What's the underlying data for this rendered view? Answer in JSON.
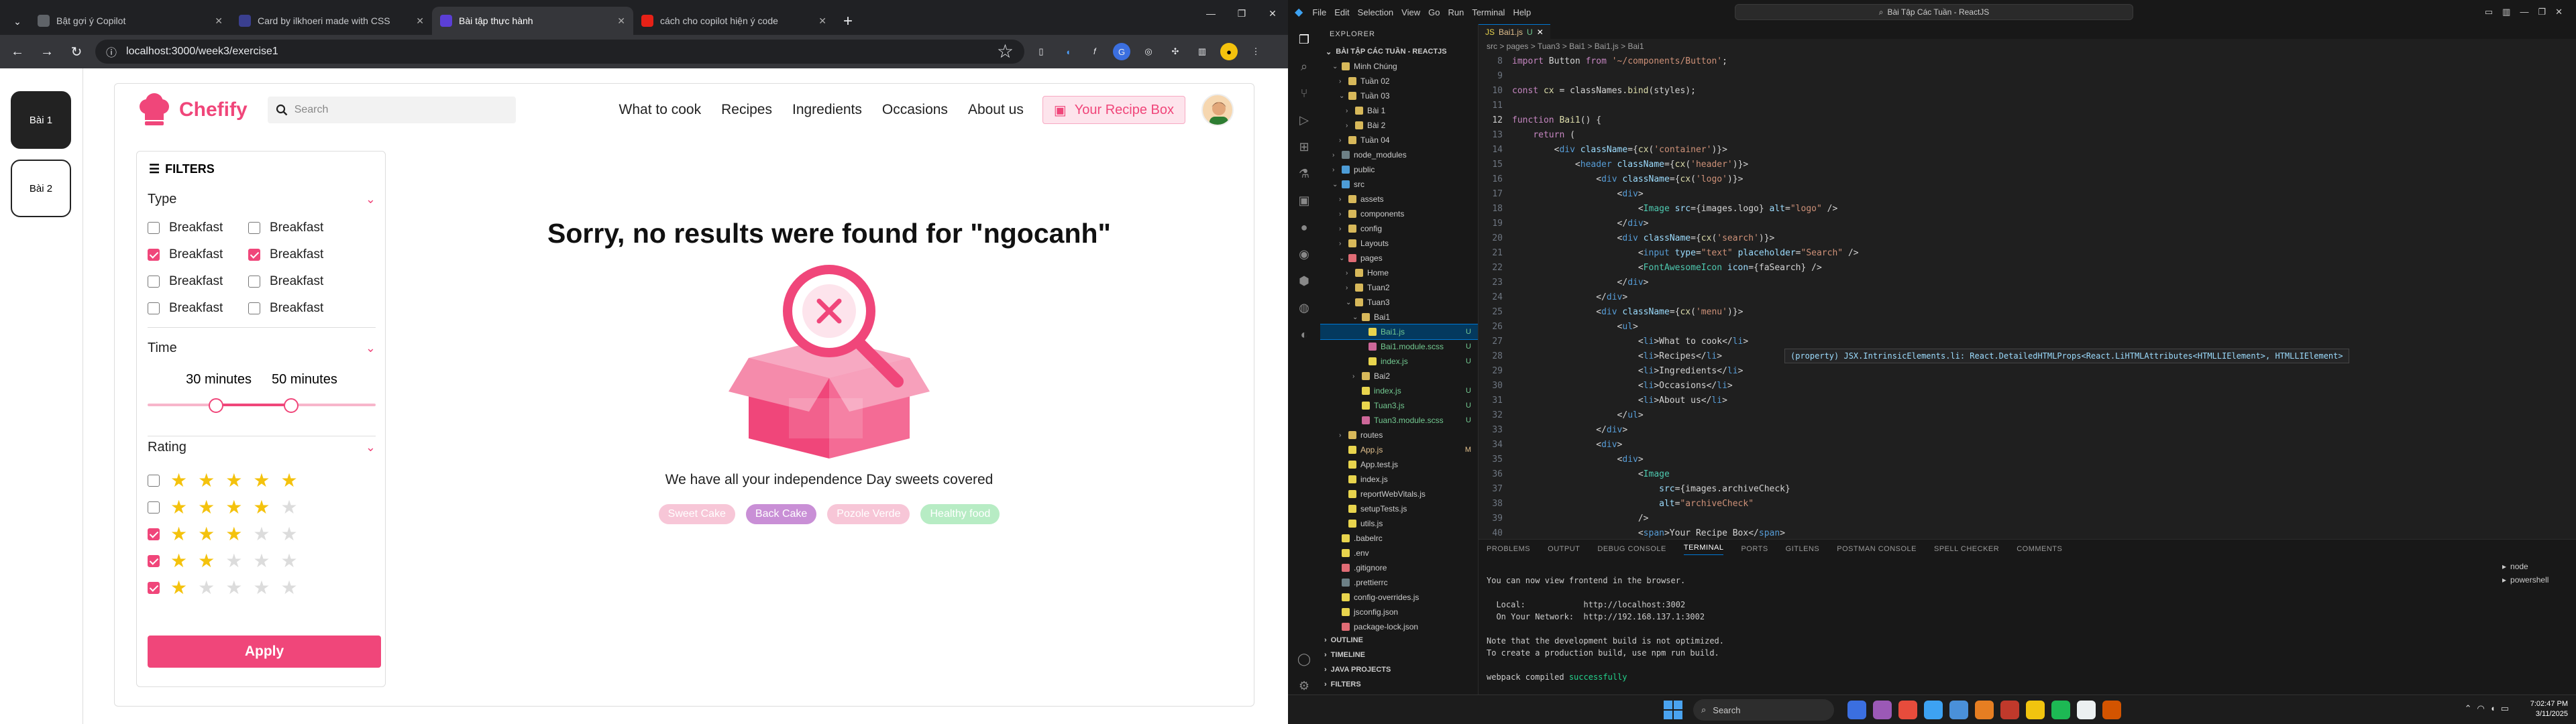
{
  "browser": {
    "tabs": [
      {
        "title": "Bật gợi ý Copilot",
        "color": "#5f6368",
        "active": false
      },
      {
        "title": "Card by ilkhoeri made with CSS",
        "color": "#3a3f8f",
        "active": false
      },
      {
        "title": "Bài tập thực hành",
        "color": "#5b3fd6",
        "active": true
      },
      {
        "title": "cách cho copilot hiện ý code",
        "color": "#e62117",
        "active": false
      }
    ],
    "url": "localhost:3000/week3/exercise1"
  },
  "lessons": [
    "Bài 1",
    "Bài 2"
  ],
  "app": {
    "brand": "Chefify",
    "search_placeholder": "Search",
    "menu": [
      "What to cook",
      "Recipes",
      "Ingredients",
      "Occasions",
      "About us"
    ],
    "recipe_box": "Your Recipe Box",
    "filters_title": "FILTERS",
    "type": {
      "label": "Type",
      "items": [
        {
          "label": "Breakfast",
          "checked": false
        },
        {
          "label": "Breakfast",
          "checked": false
        },
        {
          "label": "Breakfast",
          "checked": true
        },
        {
          "label": "Breakfast",
          "checked": true
        },
        {
          "label": "Breakfast",
          "checked": false
        },
        {
          "label": "Breakfast",
          "checked": false
        },
        {
          "label": "Breakfast",
          "checked": false
        },
        {
          "label": "Breakfast",
          "checked": false
        }
      ]
    },
    "time": {
      "label": "Time",
      "min_label": "30 minutes",
      "max_label": "50 minutes",
      "range_min": 0.3,
      "range_max": 0.63
    },
    "rating": {
      "label": "Rating",
      "rows": [
        {
          "checked": false,
          "stars": 5
        },
        {
          "checked": false,
          "stars": 4
        },
        {
          "checked": true,
          "stars": 3
        },
        {
          "checked": true,
          "stars": 2
        },
        {
          "checked": true,
          "stars": 1
        }
      ]
    },
    "apply_label": "Apply",
    "result_title": "Sorry, no results were found for \"ngocanh\"",
    "result_sub": "We have all your independence Day sweets covered",
    "chips": [
      {
        "label": "Sweet Cake",
        "color": "#f7c6d7"
      },
      {
        "label": "Back Cake",
        "color": "#c98fd6"
      },
      {
        "label": "Pozole Verde",
        "color": "#f7c6d7"
      },
      {
        "label": "Healthy food",
        "color": "#b7ecc4"
      }
    ]
  },
  "vscode": {
    "menu": [
      "File",
      "Edit",
      "Selection",
      "View",
      "Go",
      "Run",
      "Terminal",
      "Help"
    ],
    "search": "Bài Tập Các Tuần - ReactJS",
    "explorer_title": "EXPLORER",
    "root": "BÀI TẬP CÁC TUẦN - REACTJS",
    "tree": [
      {
        "name": "Minh Chúng",
        "depth": 1,
        "kind": "folder",
        "open": true,
        "color": "#d7b85a",
        "badge": "",
        "selected": false
      },
      {
        "name": "Tuần 02",
        "depth": 2,
        "kind": "folder",
        "open": false,
        "color": "#d7b85a",
        "badge": "",
        "selected": false
      },
      {
        "name": "Tuần 03",
        "depth": 2,
        "kind": "folder",
        "open": true,
        "color": "#d7b85a",
        "badge": "",
        "selected": false
      },
      {
        "name": "Bài 1",
        "depth": 3,
        "kind": "folder",
        "open": false,
        "color": "#d7b85a",
        "badge": "",
        "selected": false
      },
      {
        "name": "Bài 2",
        "depth": 3,
        "kind": "folder",
        "open": false,
        "color": "#d7b85a",
        "badge": "",
        "selected": false
      },
      {
        "name": "Tuần 04",
        "depth": 2,
        "kind": "folder",
        "open": false,
        "color": "#d7b85a",
        "badge": "",
        "selected": false
      },
      {
        "name": "node_modules",
        "depth": 1,
        "kind": "folder",
        "open": false,
        "color": "#6d8086",
        "badge": "",
        "selected": false
      },
      {
        "name": "public",
        "depth": 1,
        "kind": "folder",
        "open": false,
        "color": "#4d9cd6",
        "badge": "",
        "selected": false
      },
      {
        "name": "src",
        "depth": 1,
        "kind": "folder",
        "open": true,
        "color": "#4d9cd6",
        "badge": "",
        "selected": false
      },
      {
        "name": "assets",
        "depth": 2,
        "kind": "folder",
        "open": false,
        "color": "#d7b85a",
        "badge": "",
        "selected": false
      },
      {
        "name": "components",
        "depth": 2,
        "kind": "folder",
        "open": false,
        "color": "#d7b85a",
        "badge": "",
        "selected": false
      },
      {
        "name": "config",
        "depth": 2,
        "kind": "folder",
        "open": false,
        "color": "#d7b85a",
        "badge": "",
        "selected": false
      },
      {
        "name": "Layouts",
        "depth": 2,
        "kind": "folder",
        "open": false,
        "color": "#d7b85a",
        "badge": "",
        "selected": false
      },
      {
        "name": "pages",
        "depth": 2,
        "kind": "folder",
        "open": true,
        "color": "#e06c75",
        "badge": "",
        "selected": false
      },
      {
        "name": "Home",
        "depth": 3,
        "kind": "folder",
        "open": false,
        "color": "#d7b85a",
        "badge": "",
        "selected": false
      },
      {
        "name": "Tuan2",
        "depth": 3,
        "kind": "folder",
        "open": false,
        "color": "#d7b85a",
        "badge": "",
        "selected": false
      },
      {
        "name": "Tuan3",
        "depth": 3,
        "kind": "folder",
        "open": true,
        "color": "#d7b85a",
        "badge": "",
        "selected": false
      },
      {
        "name": "Bai1",
        "depth": 4,
        "kind": "folder",
        "open": true,
        "color": "#d7b85a",
        "badge": "",
        "selected": false
      },
      {
        "name": "Bai1.js",
        "depth": 5,
        "kind": "file",
        "open": false,
        "color": "#e8d44d",
        "badge": "U",
        "selected": true
      },
      {
        "name": "Bai1.module.scss",
        "depth": 5,
        "kind": "file",
        "open": false,
        "color": "#cd6799",
        "badge": "U",
        "selected": false
      },
      {
        "name": "index.js",
        "depth": 5,
        "kind": "file",
        "open": false,
        "color": "#e8d44d",
        "badge": "U",
        "selected": false
      },
      {
        "name": "Bai2",
        "depth": 4,
        "kind": "folder",
        "open": false,
        "color": "#d7b85a",
        "badge": "",
        "selected": false
      },
      {
        "name": "index.js",
        "depth": 4,
        "kind": "file",
        "open": false,
        "color": "#e8d44d",
        "badge": "U",
        "selected": false
      },
      {
        "name": "Tuan3.js",
        "depth": 4,
        "kind": "file",
        "open": false,
        "color": "#e8d44d",
        "badge": "U",
        "selected": false
      },
      {
        "name": "Tuan3.module.scss",
        "depth": 4,
        "kind": "file",
        "open": false,
        "color": "#cd6799",
        "badge": "U",
        "selected": false
      },
      {
        "name": "routes",
        "depth": 2,
        "kind": "folder",
        "open": false,
        "color": "#d7b85a",
        "badge": "",
        "selected": false
      },
      {
        "name": "App.js",
        "depth": 2,
        "kind": "file",
        "open": false,
        "color": "#e8d44d",
        "badge": "M",
        "selected": false
      },
      {
        "name": "App.test.js",
        "depth": 2,
        "kind": "file",
        "open": false,
        "color": "#e8d44d",
        "badge": "",
        "selected": false
      },
      {
        "name": "index.js",
        "depth": 2,
        "kind": "file",
        "open": false,
        "color": "#e8d44d",
        "badge": "",
        "selected": false
      },
      {
        "name": "reportWebVitals.js",
        "depth": 2,
        "kind": "file",
        "open": false,
        "color": "#e8d44d",
        "badge": "",
        "selected": false
      },
      {
        "name": "setupTests.js",
        "depth": 2,
        "kind": "file",
        "open": false,
        "color": "#e8d44d",
        "badge": "",
        "selected": false
      },
      {
        "name": "utils.js",
        "depth": 2,
        "kind": "file",
        "open": false,
        "color": "#e8d44d",
        "badge": "",
        "selected": false
      },
      {
        "name": ".babelrc",
        "depth": 1,
        "kind": "file",
        "open": false,
        "color": "#e8d44d",
        "badge": "",
        "selected": false
      },
      {
        "name": ".env",
        "depth": 1,
        "kind": "file",
        "open": false,
        "color": "#e8d44d",
        "badge": "",
        "selected": false
      },
      {
        "name": ".gitignore",
        "depth": 1,
        "kind": "file",
        "open": false,
        "color": "#e06c75",
        "badge": "",
        "selected": false
      },
      {
        "name": ".prettierrc",
        "depth": 1,
        "kind": "file",
        "open": false,
        "color": "#6d8086",
        "badge": "",
        "selected": false
      },
      {
        "name": "config-overrides.js",
        "depth": 1,
        "kind": "file",
        "open": false,
        "color": "#e8d44d",
        "badge": "",
        "selected": false
      },
      {
        "name": "jsconfig.json",
        "depth": 1,
        "kind": "file",
        "open": false,
        "color": "#e8d44d",
        "badge": "",
        "selected": false
      },
      {
        "name": "package-lock.json",
        "depth": 1,
        "kind": "file",
        "open": false,
        "color": "#e06c75",
        "badge": "",
        "selected": false
      }
    ],
    "outline_sections": [
      "OUTLINE",
      "TIMELINE",
      "JAVA PROJECTS",
      "FILTERS"
    ],
    "editor_tab": "Bai1.js",
    "editor_tab_badge": "U",
    "breadcrumb": "src > pages > Tuan3 > Bai1 > Bai1.js > Bai1",
    "code": [
      {
        "n": "8",
        "text": "import Button from '~/components/Button';"
      },
      {
        "n": "9",
        "text": ""
      },
      {
        "n": "10",
        "text": "const cx = classNames.bind(styles);"
      },
      {
        "n": "11",
        "text": ""
      },
      {
        "n": "12",
        "text": "function Bai1() {"
      },
      {
        "n": "13",
        "text": "    return ("
      },
      {
        "n": "14",
        "text": "        <div className={cx('container')}>"
      },
      {
        "n": "15",
        "text": "            <header className={cx('header')}>"
      },
      {
        "n": "16",
        "text": "                <div className={cx('logo')}>"
      },
      {
        "n": "17",
        "text": "                    <div>"
      },
      {
        "n": "18",
        "text": "                        <Image src={images.logo} alt=\"logo\" />"
      },
      {
        "n": "19",
        "text": "                    </div>"
      },
      {
        "n": "20",
        "text": "                    <div className={cx('search')}>"
      },
      {
        "n": "21",
        "text": "                        <input type=\"text\" placeholder=\"Search\" />"
      },
      {
        "n": "22",
        "text": "                        <FontAwesomeIcon icon={faSearch} />"
      },
      {
        "n": "23",
        "text": "                    </div>"
      },
      {
        "n": "24",
        "text": "                </div>"
      },
      {
        "n": "25",
        "text": "                <div className={cx('menu')}>"
      },
      {
        "n": "26",
        "text": "                    <ul>"
      },
      {
        "n": "27",
        "text": "                        <li>What to cook</li>"
      },
      {
        "n": "28",
        "text": "                        <li>Recipes</li>"
      },
      {
        "n": "29",
        "text": "                        <li>Ingredients</li>"
      },
      {
        "n": "30",
        "text": "                        <li>Occasions</li>"
      },
      {
        "n": "31",
        "text": "                        <li>About us</li>"
      },
      {
        "n": "32",
        "text": "                    </ul>"
      },
      {
        "n": "33",
        "text": "                </div>"
      },
      {
        "n": "34",
        "text": "                <div>"
      },
      {
        "n": "35",
        "text": "                    <div>"
      },
      {
        "n": "36",
        "text": "                        <Image"
      },
      {
        "n": "37",
        "text": "                            src={images.archiveCheck}"
      },
      {
        "n": "38",
        "text": "                            alt=\"archiveCheck\""
      },
      {
        "n": "39",
        "text": "                        />"
      },
      {
        "n": "40",
        "text": "                        <span>Your Recipe Box</span>"
      }
    ],
    "hover_text": "(property) JSX.IntrinsicElements.li: React.DetailedHTMLProps<React.LiHTMLAttributes<HTMLLIElement>, HTMLLIElement>",
    "panel_tabs": [
      "PROBLEMS",
      "OUTPUT",
      "DEBUG CONSOLE",
      "TERMINAL",
      "PORTS",
      "GITLENS",
      "POSTMAN CONSOLE",
      "SPELL CHECKER",
      "COMMENTS"
    ],
    "terminal": [
      "You can now view frontend in the browser.",
      "",
      "  Local:            http://localhost:3002",
      "  On Your Network:  http://192.168.137.1:3002",
      "",
      "Note that the development build is not optimized.",
      "To create a production build, use npm run build.",
      "",
      "webpack compiled successfully"
    ],
    "terminals": [
      "node",
      "powershell"
    ]
  },
  "taskbar": {
    "search": "Search",
    "time": "7:02:47 PM",
    "date": "3/11/2025"
  }
}
